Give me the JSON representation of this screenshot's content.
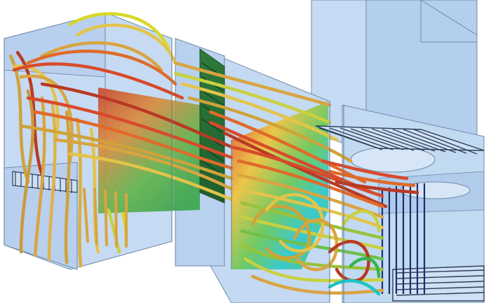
{
  "scene": {
    "kind": "3d-cfd-streamline-visualization",
    "background_color": "#ffffff",
    "housing_fill_color": "#bcd6f2",
    "housing_edge_color": "#6f8aa8",
    "fin_color": "#2c3e57",
    "colormap": [
      "#1f3b8f",
      "#19c6c6",
      "#35b44a",
      "#d8d82a",
      "#e9a12a",
      "#d83a1f"
    ],
    "streamline_palette": [
      "#d9a441",
      "#e3c44a",
      "#c9d040",
      "#b83a24",
      "#e06a2a",
      "#d84a2a",
      "#9ac23c",
      "#cfa23a"
    ],
    "visible_text": []
  }
}
